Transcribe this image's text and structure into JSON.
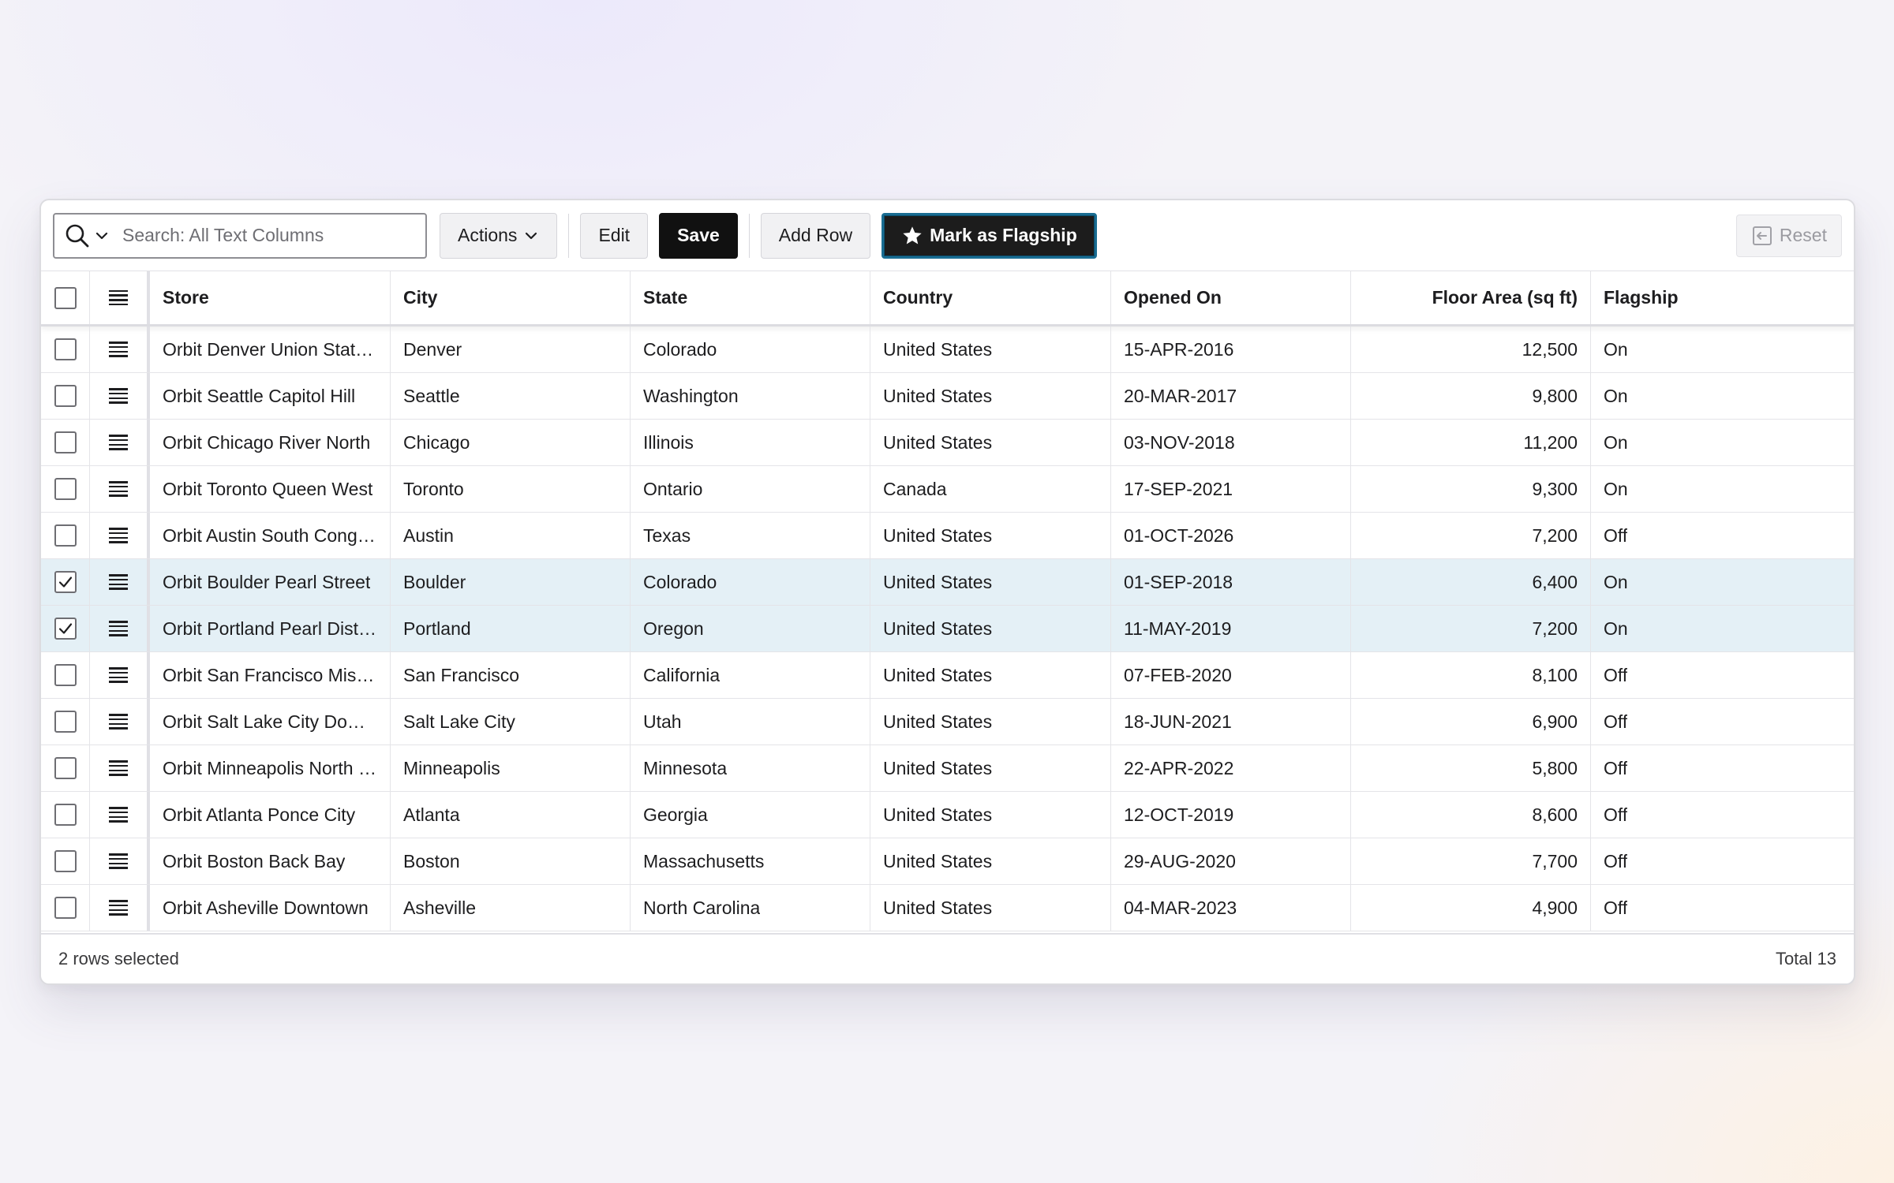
{
  "toolbar": {
    "search_placeholder": "Search: All Text Columns",
    "search_value": "",
    "actions_label": "Actions",
    "edit_label": "Edit",
    "save_label": "Save",
    "add_row_label": "Add Row",
    "mark_flagship_label": "Mark as Flagship",
    "reset_label": "Reset"
  },
  "columns": [
    "Store",
    "City",
    "State",
    "Country",
    "Opened On",
    "Floor Area (sq ft)",
    "Flagship"
  ],
  "rows": [
    {
      "selected": false,
      "store": "Orbit Denver Union Stati…",
      "city": "Denver",
      "state": "Colorado",
      "country": "United States",
      "opened": "15-APR-2016",
      "area": "12,500",
      "flagship": "On"
    },
    {
      "selected": false,
      "store": "Orbit Seattle Capitol Hill",
      "city": "Seattle",
      "state": "Washington",
      "country": "United States",
      "opened": "20-MAR-2017",
      "area": "9,800",
      "flagship": "On"
    },
    {
      "selected": false,
      "store": "Orbit Chicago River North",
      "city": "Chicago",
      "state": "Illinois",
      "country": "United States",
      "opened": "03-NOV-2018",
      "area": "11,200",
      "flagship": "On"
    },
    {
      "selected": false,
      "store": "Orbit Toronto Queen West",
      "city": "Toronto",
      "state": "Ontario",
      "country": "Canada",
      "opened": "17-SEP-2021",
      "area": "9,300",
      "flagship": "On"
    },
    {
      "selected": false,
      "store": "Orbit Austin South Cong…",
      "city": "Austin",
      "state": "Texas",
      "country": "United States",
      "opened": "01-OCT-2026",
      "area": "7,200",
      "flagship": "Off"
    },
    {
      "selected": true,
      "store": "Orbit Boulder Pearl Street",
      "city": "Boulder",
      "state": "Colorado",
      "country": "United States",
      "opened": "01-SEP-2018",
      "area": "6,400",
      "flagship": "On"
    },
    {
      "selected": true,
      "store": "Orbit Portland Pearl Dist…",
      "city": "Portland",
      "state": "Oregon",
      "country": "United States",
      "opened": "11-MAY-2019",
      "area": "7,200",
      "flagship": "On"
    },
    {
      "selected": false,
      "store": "Orbit San Francisco Mis…",
      "city": "San Francisco",
      "state": "California",
      "country": "United States",
      "opened": "07-FEB-2020",
      "area": "8,100",
      "flagship": "Off"
    },
    {
      "selected": false,
      "store": "Orbit Salt Lake City Dow…",
      "city": "Salt Lake City",
      "state": "Utah",
      "country": "United States",
      "opened": "18-JUN-2021",
      "area": "6,900",
      "flagship": "Off"
    },
    {
      "selected": false,
      "store": "Orbit Minneapolis North …",
      "city": "Minneapolis",
      "state": "Minnesota",
      "country": "United States",
      "opened": "22-APR-2022",
      "area": "5,800",
      "flagship": "Off"
    },
    {
      "selected": false,
      "store": "Orbit Atlanta Ponce City",
      "city": "Atlanta",
      "state": "Georgia",
      "country": "United States",
      "opened": "12-OCT-2019",
      "area": "8,600",
      "flagship": "Off"
    },
    {
      "selected": false,
      "store": "Orbit Boston Back Bay",
      "city": "Boston",
      "state": "Massachusetts",
      "country": "United States",
      "opened": "29-AUG-2020",
      "area": "7,700",
      "flagship": "Off"
    },
    {
      "selected": false,
      "store": "Orbit Asheville Downtown",
      "city": "Asheville",
      "state": "North Carolina",
      "country": "United States",
      "opened": "04-MAR-2023",
      "area": "4,900",
      "flagship": "Off"
    }
  ],
  "footer": {
    "selection_text": "2 rows selected",
    "total_text": "Total 13"
  },
  "icons": {
    "search": "search-icon",
    "chevron": "chevron-down-icon",
    "star": "star-icon",
    "reset": "reset-icon",
    "row_menu": "hamburger-icon",
    "checkbox": "checkbox"
  },
  "colors": {
    "selected_row": "#e4f0f6",
    "save_button": "#111111",
    "flagship_button_border": "#1a6d92"
  }
}
